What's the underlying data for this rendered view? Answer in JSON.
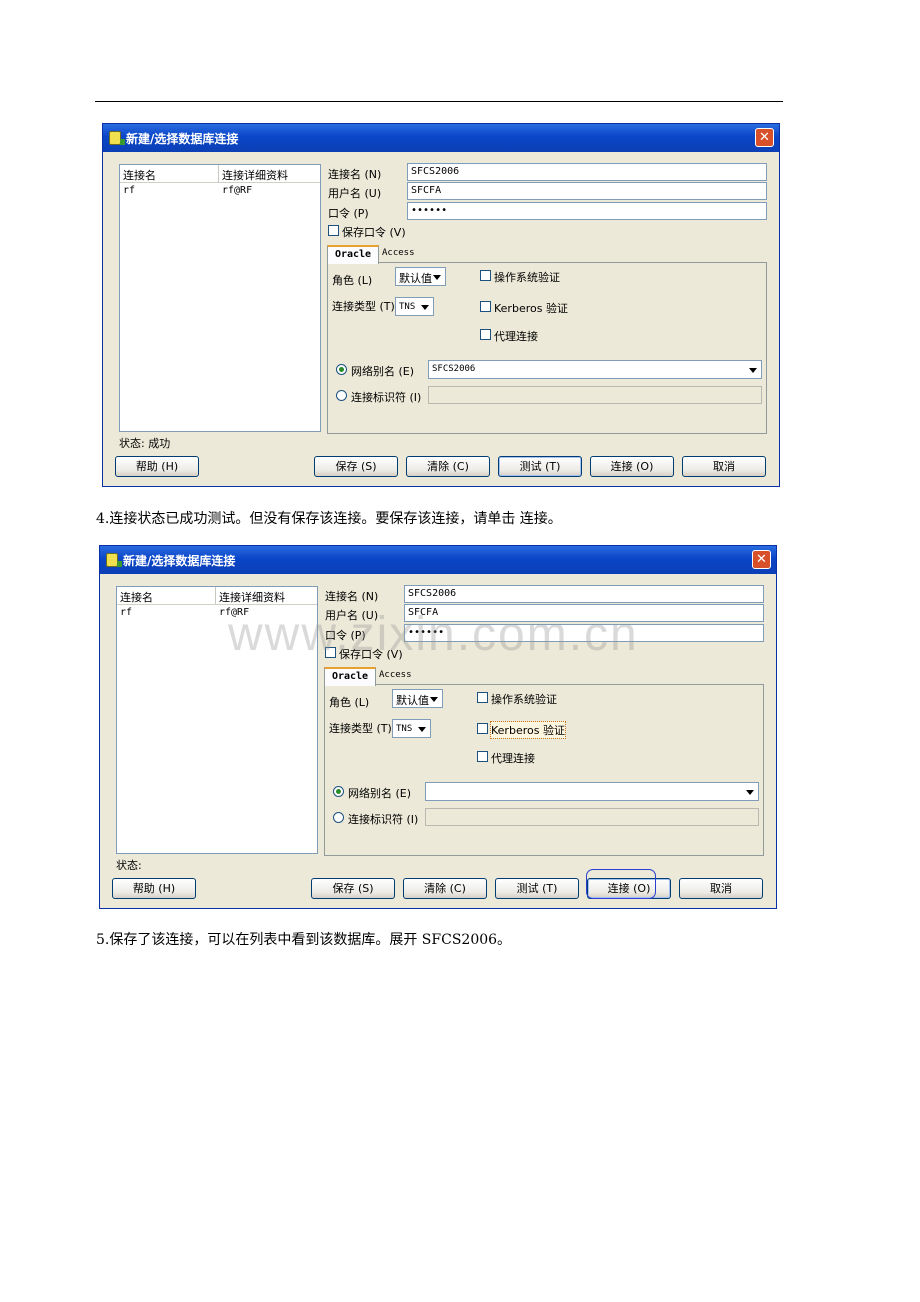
{
  "dialog_title": "新建/选择数据库连接",
  "list": {
    "col1": "连接名",
    "col2": "连接详细资料",
    "row_name": "rf",
    "row_detail": "rf@RF"
  },
  "fields": {
    "conn_name_label": "连接名 (N)",
    "user_label": "用户名 (U)",
    "password_label": "口令 (P)",
    "save_password_label": "保存口令 (V)",
    "conn_name_value": "SFCS2006",
    "user_value": "SFCFA",
    "password_value": "••••••"
  },
  "tabs": {
    "oracle": "Oracle",
    "access": "Access"
  },
  "oracle": {
    "role_label": "角色 (L)",
    "role_value": "默认值",
    "conn_type_label": "连接类型 (T)",
    "conn_type_value": "TNS",
    "os_auth": "操作系统验证",
    "kerberos": "Kerberos 验证",
    "proxy": "代理连接",
    "net_alias_label": "网络别名 (E)",
    "conn_id_label": "连接标识符 (I)"
  },
  "buttons": {
    "help": "帮助 (H)",
    "save": "保存 (S)",
    "clear": "清除 (C)",
    "test": "测试 (T)",
    "connect": "连接 (O)",
    "cancel": "取消"
  },
  "dialog1": {
    "status": "状态: 成功",
    "net_alias_value": "SFCS2006"
  },
  "dialog2": {
    "status": "状态:",
    "net_alias_value": ""
  },
  "paragraphs": {
    "step4": "4.连接状态已成功测试。但没有保存该连接。要保存该连接，请单击 连接。",
    "step5": "5.保存了该连接，可以在列表中看到该数据库。展开 SFCS2006。"
  },
  "watermark": "www.zixin.com.cn",
  "colors": {
    "titlebar": "#0a46c8",
    "dialog_bg": "#ece9d8",
    "highlight": "#2a3fd0"
  }
}
